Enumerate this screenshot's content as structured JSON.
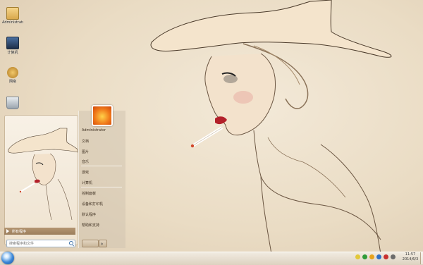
{
  "desktop": {
    "icons": [
      {
        "name": "folder",
        "label": "Administrator"
      },
      {
        "name": "computer",
        "label": "计算机"
      },
      {
        "name": "network",
        "label": "网络"
      },
      {
        "name": "recycle-bin",
        "label": ""
      }
    ]
  },
  "start_menu": {
    "left_items": [],
    "all_programs": "所有程序",
    "search_placeholder": "搜索程序和文件",
    "right_items": [
      "Administrator",
      "文档",
      "图片",
      "音乐",
      "游戏",
      "计算机",
      "控制面板",
      "设备和打印机",
      "默认程序",
      "帮助和支持"
    ],
    "shutdown_label": "关机"
  },
  "taskbar": {
    "clock_time": "11:57",
    "clock_date": "2014/6/3"
  },
  "colors": {
    "wallpaper": "#eadcc4",
    "start_panel": "#efe3d0",
    "all_programs_bar": "#9c7e5c",
    "taskbar": "#ddd2c0"
  }
}
